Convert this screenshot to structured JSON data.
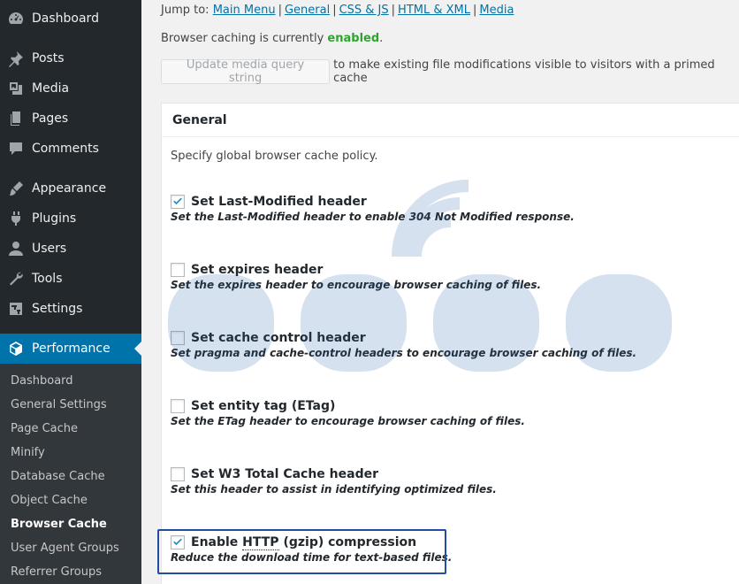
{
  "sidebar": {
    "menu": [
      {
        "label": "Dashboard",
        "icon": "dashboard-icon"
      },
      {
        "label": "Posts",
        "icon": "pin-icon"
      },
      {
        "label": "Media",
        "icon": "media-icon"
      },
      {
        "label": "Pages",
        "icon": "pages-icon"
      },
      {
        "label": "Comments",
        "icon": "comments-icon"
      },
      {
        "label": "Appearance",
        "icon": "brush-icon"
      },
      {
        "label": "Plugins",
        "icon": "plug-icon"
      },
      {
        "label": "Users",
        "icon": "user-icon"
      },
      {
        "label": "Tools",
        "icon": "wrench-icon"
      },
      {
        "label": "Settings",
        "icon": "settings-icon"
      },
      {
        "label": "Performance",
        "icon": "cube-icon",
        "active": true
      }
    ],
    "submenu": [
      {
        "label": "Dashboard"
      },
      {
        "label": "General Settings"
      },
      {
        "label": "Page Cache"
      },
      {
        "label": "Minify"
      },
      {
        "label": "Database Cache"
      },
      {
        "label": "Object Cache"
      },
      {
        "label": "Browser Cache",
        "current": true
      },
      {
        "label": "User Agent Groups"
      },
      {
        "label": "Referrer Groups"
      }
    ],
    "colors": {
      "background": "#23282d",
      "active": "#0073aa",
      "submenu": "#32373c"
    }
  },
  "jump": {
    "prefix": "Jump to:",
    "links": [
      "Main Menu",
      "General",
      "CSS & JS",
      "HTML & XML",
      "Media"
    ],
    "separator": "|"
  },
  "status": {
    "text": "Browser caching is currently",
    "value": "enabled",
    "end": "."
  },
  "media_query": {
    "button_label": "Update media query string",
    "after_text": "to make existing file modifications visible to visitors with a primed cache"
  },
  "general": {
    "title": "General",
    "description": "Specify global browser cache policy.",
    "options": [
      {
        "title": "Set Last-Modified header",
        "desc": "Set the Last-Modified header to enable 304 Not Modified response.",
        "checked": true
      },
      {
        "title": "Set expires header",
        "desc": "Set the expires header to encourage browser caching of files.",
        "checked": false
      },
      {
        "title": "Set cache control header",
        "desc": "Set pragma and cache-control headers to encourage browser caching of files.",
        "checked": false
      },
      {
        "title": "Set entity tag (ETag)",
        "desc": "Set the ETag header to encourage browser caching of files.",
        "checked": false
      },
      {
        "title": "Set W3 Total Cache header",
        "desc": "Set this header to assist in identifying optimized files.",
        "checked": false
      },
      {
        "title_pre": "Enable ",
        "title_abbr": "HTTP",
        "title_post": " (gzip) compression",
        "desc": "Reduce the download time for text-based files.",
        "checked": true,
        "highlighted": true
      }
    ]
  },
  "colors": {
    "link": "#0073aa",
    "enabled": "#2ea52e",
    "highlight_border": "#1f4fa3",
    "checkbox": "#1e8cbe"
  }
}
